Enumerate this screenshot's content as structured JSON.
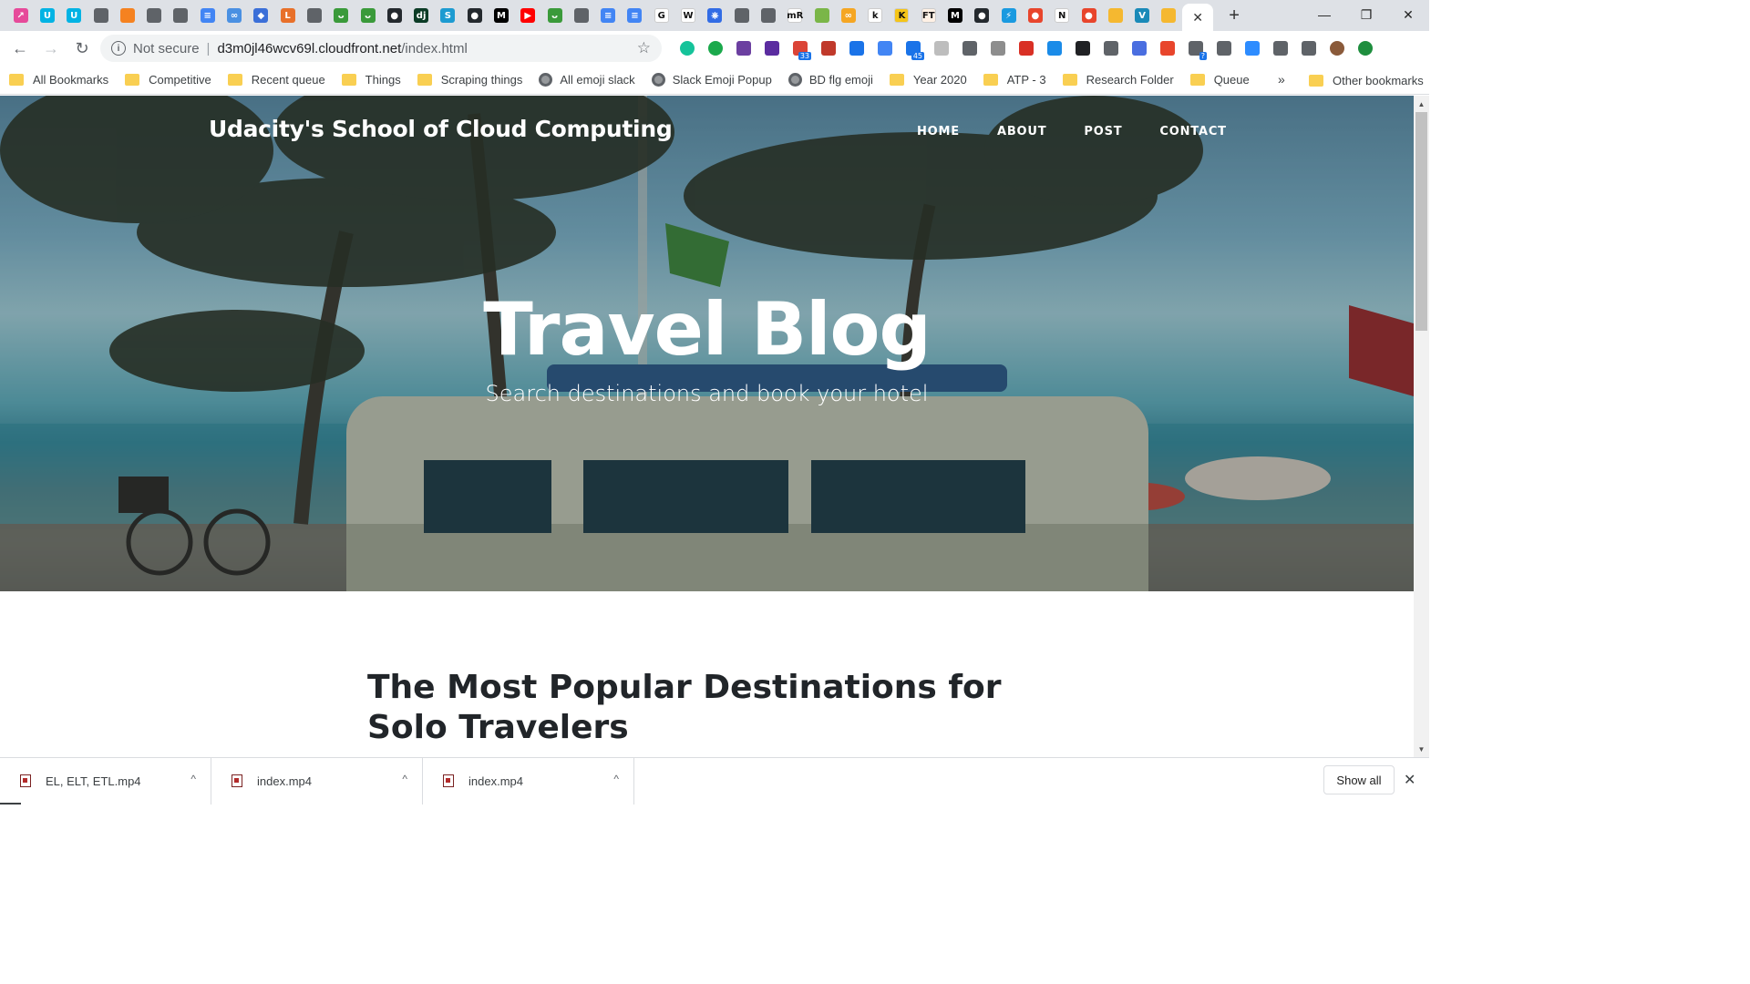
{
  "browser": {
    "tabs": [
      {
        "icon": "colorful-app-icon",
        "color": "#e64a9a",
        "glyph": "↗"
      },
      {
        "icon": "udacity-icon",
        "color": "#02b3e4",
        "glyph": "U"
      },
      {
        "icon": "udacity-icon",
        "color": "#02b3e4",
        "glyph": "U"
      },
      {
        "icon": "globe-icon",
        "color": "#5f6368",
        "glyph": ""
      },
      {
        "icon": "box-icon",
        "color": "#f58220",
        "glyph": ""
      },
      {
        "icon": "globe-icon",
        "color": "#5f6368",
        "glyph": ""
      },
      {
        "icon": "globe-icon",
        "color": "#5f6368",
        "glyph": ""
      },
      {
        "icon": "docs-icon",
        "color": "#4285f4",
        "glyph": "≡"
      },
      {
        "icon": "infinity-icon",
        "color": "#4a90e2",
        "glyph": "∞"
      },
      {
        "icon": "diamond-icon",
        "color": "#3b6fd8",
        "glyph": "◆"
      },
      {
        "icon": "lambda-icon",
        "color": "#e8702a",
        "glyph": "L"
      },
      {
        "icon": "globe-icon",
        "color": "#5f6368",
        "glyph": ""
      },
      {
        "icon": "frog-icon",
        "color": "#3a9a3a",
        "glyph": "ᴗ"
      },
      {
        "icon": "frog-icon",
        "color": "#3a9a3a",
        "glyph": "ᴗ"
      },
      {
        "icon": "github-icon",
        "color": "#24292e",
        "glyph": "●"
      },
      {
        "icon": "django-icon",
        "color": "#0c3c26",
        "glyph": "dj"
      },
      {
        "icon": "s-icon",
        "color": "#1d9bd1",
        "glyph": "S"
      },
      {
        "icon": "github-icon",
        "color": "#24292e",
        "glyph": "●"
      },
      {
        "icon": "medium-icon",
        "color": "#000000",
        "glyph": "M"
      },
      {
        "icon": "youtube-icon",
        "color": "#ff0000",
        "glyph": "▶"
      },
      {
        "icon": "frog-icon",
        "color": "#3a9a3a",
        "glyph": "ᴗ"
      },
      {
        "icon": "globe-icon",
        "color": "#5f6368",
        "glyph": ""
      },
      {
        "icon": "docs-icon",
        "color": "#4285f4",
        "glyph": "≡"
      },
      {
        "icon": "docs-icon",
        "color": "#4285f4",
        "glyph": "≡"
      },
      {
        "icon": "google-icon",
        "color": "#ffffff",
        "glyph": "G"
      },
      {
        "icon": "wikipedia-icon",
        "color": "#ffffff",
        "glyph": "W"
      },
      {
        "icon": "kubernetes-icon",
        "color": "#326ce5",
        "glyph": "⎈"
      },
      {
        "icon": "globe-icon",
        "color": "#5f6368",
        "glyph": ""
      },
      {
        "icon": "globe-icon",
        "color": "#5f6368",
        "glyph": ""
      },
      {
        "icon": "mr-icon",
        "color": "#ffffff",
        "glyph": "mR"
      },
      {
        "icon": "leaf-icon",
        "color": "#7ab648",
        "glyph": ""
      },
      {
        "icon": "infinity-icon",
        "color": "#f5a623",
        "glyph": "∞"
      },
      {
        "icon": "k-icon",
        "color": "#ffffff",
        "glyph": "k"
      },
      {
        "icon": "kaggle-k-icon",
        "color": "#f5c518",
        "glyph": "K"
      },
      {
        "icon": "ft-icon",
        "color": "#fff1e5",
        "glyph": "FT"
      },
      {
        "icon": "medium-icon",
        "color": "#000000",
        "glyph": "M"
      },
      {
        "icon": "github-icon",
        "color": "#24292e",
        "glyph": "●"
      },
      {
        "icon": "bolt-icon",
        "color": "#1a9ae0",
        "glyph": "⚡"
      },
      {
        "icon": "tomato-icon",
        "color": "#e8452c",
        "glyph": "●"
      },
      {
        "icon": "netflix-icon",
        "color": "#ffffff",
        "glyph": "N"
      },
      {
        "icon": "tomato-icon",
        "color": "#e8452c",
        "glyph": "●"
      },
      {
        "icon": "box-icon",
        "color": "#f5b830",
        "glyph": ""
      },
      {
        "icon": "v-icon",
        "color": "#1a8ab8",
        "glyph": "V"
      },
      {
        "icon": "box-icon",
        "color": "#f5b830",
        "glyph": ""
      }
    ],
    "active_tab_close": "✕",
    "new_tab": "+",
    "window": {
      "minimize": "—",
      "restore": "❐",
      "close": "✕"
    },
    "omnibox": {
      "security": "Not secure",
      "separator": "|",
      "host": "d3m0jl46wcv69l.cloudfront.net",
      "path": "/index.html"
    },
    "extensions": [
      {
        "icon": "grammarly-icon",
        "color": "#15c39a",
        "badge": ""
      },
      {
        "icon": "check-icon",
        "color": "#1ba94c",
        "badge": ""
      },
      {
        "icon": "colorpick-icon",
        "color": "#6b3fa0",
        "badge": ""
      },
      {
        "icon": "gem-icon",
        "color": "#5b2ca0",
        "badge": ""
      },
      {
        "icon": "calendar-icon",
        "color": "#db4437",
        "badge": "33"
      },
      {
        "icon": "red-book-icon",
        "color": "#c0392b",
        "badge": ""
      },
      {
        "icon": "font-icon",
        "color": "#1a73e8",
        "badge": ""
      },
      {
        "icon": "translate-icon",
        "color": "#4285f4",
        "badge": ""
      },
      {
        "icon": "screen-icon",
        "color": "#1a73e8",
        "badge": "45"
      },
      {
        "icon": "puzzle-icon",
        "color": "#bdbdbd",
        "badge": ""
      },
      {
        "icon": "bulb-icon",
        "color": "#5f6368",
        "badge": ""
      },
      {
        "icon": "image-icon",
        "color": "#8d8d8d",
        "badge": ""
      },
      {
        "icon": "cast-icon",
        "color": "#d93025",
        "badge": ""
      },
      {
        "icon": "drop-icon",
        "color": "#1a8be8",
        "badge": ""
      },
      {
        "icon": "dark-icon",
        "color": "#202124",
        "badge": ""
      },
      {
        "icon": "c-icon",
        "color": "#5f6368",
        "badge": ""
      },
      {
        "icon": "shape-icon",
        "color": "#4a6ee0",
        "badge": ""
      },
      {
        "icon": "orange-icon",
        "color": "#e8452c",
        "badge": ""
      },
      {
        "icon": "chat-icon",
        "color": "#5f6368",
        "badge": "?"
      },
      {
        "icon": "library-icon",
        "color": "#5f6368",
        "badge": ""
      },
      {
        "icon": "zoom-icon",
        "color": "#2d8cff",
        "badge": ""
      },
      {
        "icon": "link-icon",
        "color": "#5f6368",
        "badge": ""
      },
      {
        "icon": "queue-icon",
        "color": "#5f6368",
        "badge": ""
      },
      {
        "icon": "avatar-icon",
        "color": "#8a5a3a",
        "badge": ""
      },
      {
        "icon": "update-icon",
        "color": "#1e8e3e",
        "badge": ""
      }
    ]
  },
  "bookmarks": [
    {
      "label": "All Bookmarks",
      "type": "folder"
    },
    {
      "label": "Competitive",
      "type": "folder"
    },
    {
      "label": "Recent queue",
      "type": "folder"
    },
    {
      "label": "Things",
      "type": "folder"
    },
    {
      "label": "Scraping things",
      "type": "folder"
    },
    {
      "label": "All emoji slack",
      "type": "globe"
    },
    {
      "label": "Slack Emoji Popup",
      "type": "globe"
    },
    {
      "label": "BD flg emoji",
      "type": "globe"
    },
    {
      "label": "Year 2020",
      "type": "folder"
    },
    {
      "label": "ATP - 3",
      "type": "folder"
    },
    {
      "label": "Research Folder",
      "type": "folder"
    },
    {
      "label": "Queue",
      "type": "folder"
    }
  ],
  "bookmarks_more": "»",
  "other_bookmarks": "Other bookmarks",
  "page": {
    "site_title": "Udacity's School of Cloud Computing",
    "nav": [
      "HOME",
      "ABOUT",
      "POST",
      "CONTACT"
    ],
    "hero_title": "Travel Blog",
    "hero_subtitle": "Search destinations and book your hotel",
    "post_title": "The Most Popular Destinations for Solo Travelers"
  },
  "scrollbar": {
    "up": "▲",
    "down": "▼"
  },
  "downloads": [
    {
      "filename": "EL, ELT, ETL.mp4",
      "progress": 0.1
    },
    {
      "filename": "index.mp4",
      "progress": 0
    },
    {
      "filename": "index.mp4",
      "progress": 0
    }
  ],
  "download_chevron": "^",
  "show_all": "Show all",
  "shelf_close": "✕"
}
